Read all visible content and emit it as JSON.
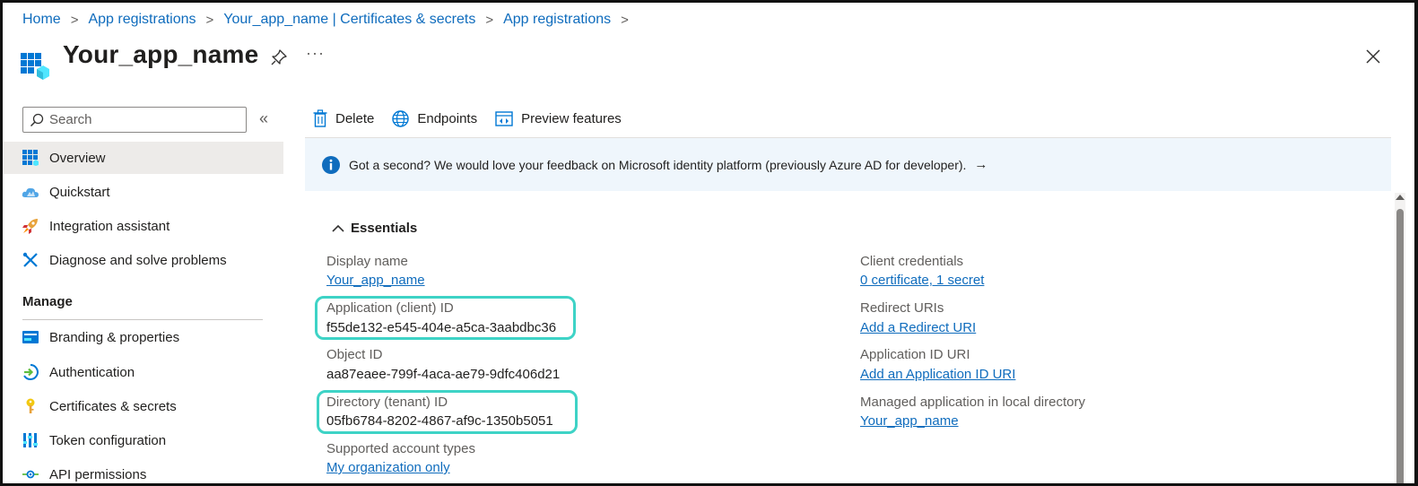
{
  "breadcrumb": [
    {
      "label": "Home"
    },
    {
      "label": "App registrations"
    },
    {
      "label": "Your_app_name | Certificates & secrets"
    },
    {
      "label": "App registrations"
    }
  ],
  "header": {
    "title": "Your_app_name",
    "more": "···",
    "icons": {
      "app": "app-grid-icon",
      "pin": "pin-icon",
      "close": "close-icon"
    }
  },
  "sidebar": {
    "search_placeholder": "Search",
    "collapse_label": "«",
    "items": [
      {
        "label": "Overview",
        "icon": "overview-grid-icon",
        "active": true
      },
      {
        "label": "Quickstart",
        "icon": "quickstart-cloud-icon"
      },
      {
        "label": "Integration assistant",
        "icon": "rocket-icon"
      },
      {
        "label": "Diagnose and solve problems",
        "icon": "wrench-icon"
      }
    ],
    "section_title": "Manage",
    "manage_items": [
      {
        "label": "Branding & properties",
        "icon": "branding-card-icon"
      },
      {
        "label": "Authentication",
        "icon": "authentication-icon"
      },
      {
        "label": "Certificates & secrets",
        "icon": "key-icon"
      },
      {
        "label": "Token configuration",
        "icon": "token-bars-icon"
      },
      {
        "label": "API permissions",
        "icon": "api-permissions-icon"
      }
    ]
  },
  "toolbar": {
    "delete_label": "Delete",
    "endpoints_label": "Endpoints",
    "preview_label": "Preview features"
  },
  "banner": {
    "text": "Got a second? We would love your feedback on Microsoft identity platform (previously Azure AD for developer).",
    "arrow": "→"
  },
  "essentials": {
    "title": "Essentials",
    "left": {
      "display_name_label": "Display name",
      "display_name_value": "Your_app_name",
      "client_id_label": "Application (client) ID",
      "client_id_value": "f55de132-e545-404e-a5ca-3aabdbc36",
      "object_id_label": "Object ID",
      "object_id_value": "aa87eaee-799f-4aca-ae79-9dfc406d21",
      "tenant_id_label": "Directory (tenant) ID",
      "tenant_id_value": "05fb6784-8202-4867-af9c-1350b5051",
      "account_types_label": "Supported account types",
      "account_types_value": "My organization only"
    },
    "right": {
      "credentials_label": "Client credentials",
      "credentials_value": "0 certificate, 1 secret",
      "redirect_label": "Redirect URIs",
      "redirect_value": "Add a Redirect URI",
      "app_id_uri_label": "Application ID URI",
      "app_id_uri_value": "Add an Application ID URI",
      "managed_app_label": "Managed application in local directory",
      "managed_app_value": "Your_app_name"
    }
  },
  "colors": {
    "link": "#0f6cbd",
    "highlight": "#3ed3c6",
    "banner_bg": "#eff6fc",
    "active_nav_bg": "#edebe9"
  }
}
